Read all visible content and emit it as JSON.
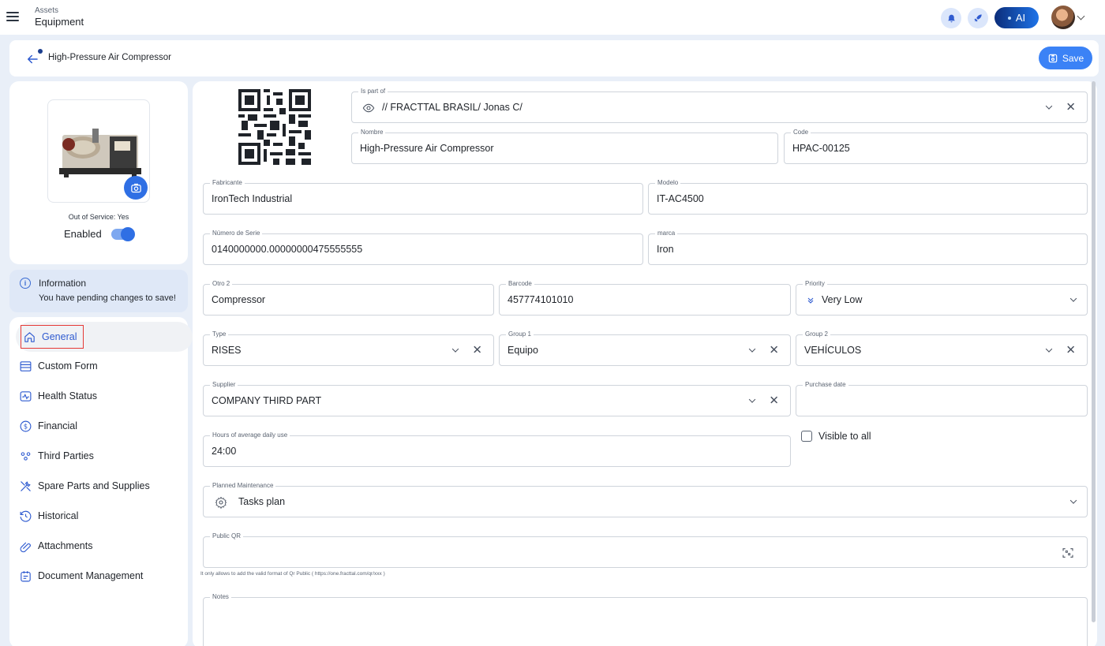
{
  "topbar": {
    "crumb_parent": "Assets",
    "crumb_current": "Equipment",
    "ai_label": "AI",
    "icons": [
      "menu-icon",
      "bell-icon",
      "rocket-icon",
      "avatar",
      "chevron-down-icon"
    ]
  },
  "header": {
    "title": "High-Pressure Air Compressor",
    "save_label": "Save"
  },
  "asset": {
    "out_of_service": "Out of Service: Yes",
    "enabled_label": "Enabled",
    "enabled": true
  },
  "info": {
    "title": "Information",
    "message": "You have pending changes to save!"
  },
  "sidebar": {
    "items": [
      {
        "label": "General",
        "icon": "home-icon",
        "active": true
      },
      {
        "label": "Custom Form",
        "icon": "form-icon"
      },
      {
        "label": "Health Status",
        "icon": "health-icon"
      },
      {
        "label": "Financial",
        "icon": "dollar-icon"
      },
      {
        "label": "Third Parties",
        "icon": "people-icon"
      },
      {
        "label": "Spare Parts and Supplies",
        "icon": "tools-icon"
      },
      {
        "label": "Historical",
        "icon": "history-icon"
      },
      {
        "label": "Attachments",
        "icon": "paperclip-icon"
      },
      {
        "label": "Document Management",
        "icon": "document-icon"
      }
    ]
  },
  "form": {
    "is_part_of": {
      "label": "Is part of",
      "value": "// FRACTTAL BRASIL/ Jonas C/"
    },
    "nombre": {
      "label": "Nombre",
      "value": "High-Pressure Air Compressor"
    },
    "code": {
      "label": "Code",
      "value": "HPAC-00125"
    },
    "fabricante": {
      "label": "Fabricante",
      "value": "IronTech Industrial"
    },
    "modelo": {
      "label": "Modelo",
      "value": "IT-AC4500"
    },
    "serie": {
      "label": "Número de Serie",
      "value": "0140000000.00000000475555555"
    },
    "marca": {
      "label": "marca",
      "value": "Iron"
    },
    "otro2": {
      "label": "Otro 2",
      "value": "Compressor"
    },
    "barcode": {
      "label": "Barcode",
      "value": "457774101010"
    },
    "priority": {
      "label": "Priority",
      "value": "Very Low"
    },
    "type": {
      "label": "Type",
      "value": "RISES"
    },
    "group1": {
      "label": "Group 1",
      "value": "Equipo"
    },
    "group2": {
      "label": "Group 2",
      "value": "VEHÍCULOS"
    },
    "supplier": {
      "label": "Supplier",
      "value": "COMPANY THIRD PART"
    },
    "purchase_date": {
      "label": "Purchase date",
      "value": ""
    },
    "hours": {
      "label": "Hours of average daily use",
      "value": "24:00"
    },
    "visible_all": {
      "label": "Visible to all",
      "checked": false
    },
    "planned": {
      "label": "Planned Maintenance",
      "value": "Tasks plan"
    },
    "public_qr": {
      "label": "Public QR",
      "value": "",
      "helper": "It only allows to add the valid format of Qr Public ( https://one.fracttal.com/qr/xxx )"
    },
    "notes": {
      "label": "Notes",
      "value": ""
    }
  },
  "colors": {
    "accent": "#3b82f6",
    "active_nav": "#2f5bd0",
    "highlight_border": "#e53935",
    "background": "#e9eff8"
  }
}
